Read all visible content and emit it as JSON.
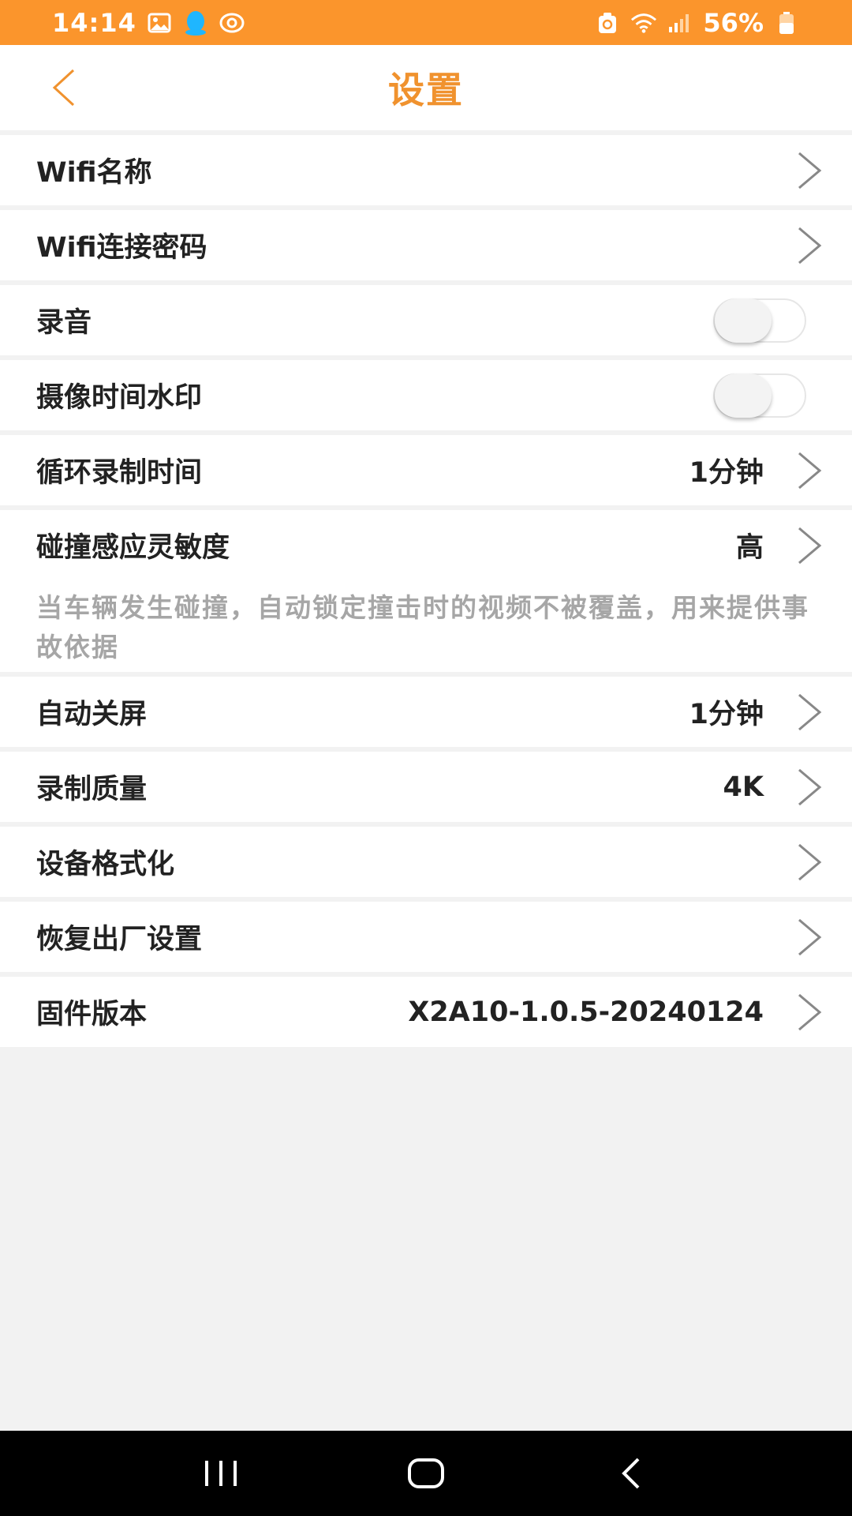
{
  "status_bar": {
    "time": "14:14",
    "battery": "56%"
  },
  "header": {
    "title": "设置"
  },
  "settings": {
    "wifi_name": {
      "label": "Wifi名称"
    },
    "wifi_password": {
      "label": "Wifi连接密码"
    },
    "audio_recording": {
      "label": "录音",
      "enabled": false
    },
    "time_watermark": {
      "label": "摄像时间水印",
      "enabled": false
    },
    "loop_recording": {
      "label": "循环录制时间",
      "value": "1分钟"
    },
    "collision_sensitivity": {
      "label": "碰撞感应灵敏度",
      "value": "高",
      "description": "当车辆发生碰撞，自动锁定撞击时的视频不被覆盖，用来提供事故依据"
    },
    "auto_screen_off": {
      "label": "自动关屏",
      "value": "1分钟"
    },
    "recording_quality": {
      "label": "录制质量",
      "value": "4K"
    },
    "format_device": {
      "label": "设备格式化"
    },
    "factory_reset": {
      "label": "恢复出厂设置"
    },
    "firmware_version": {
      "label": "固件版本",
      "value": "X2A10-1.0.5-20240124"
    }
  },
  "colors": {
    "accent": "#fb952c",
    "title": "#f0922e",
    "background": "#f2f2f2",
    "description": "#a6a6a6"
  },
  "icons": {
    "status_left": [
      "gallery-icon",
      "qq-icon",
      "eye-icon"
    ],
    "status_right": [
      "sync-icon",
      "wifi-icon",
      "signal-icon",
      "battery-icon"
    ],
    "nav": [
      "recents-icon",
      "home-icon",
      "back-icon"
    ]
  }
}
